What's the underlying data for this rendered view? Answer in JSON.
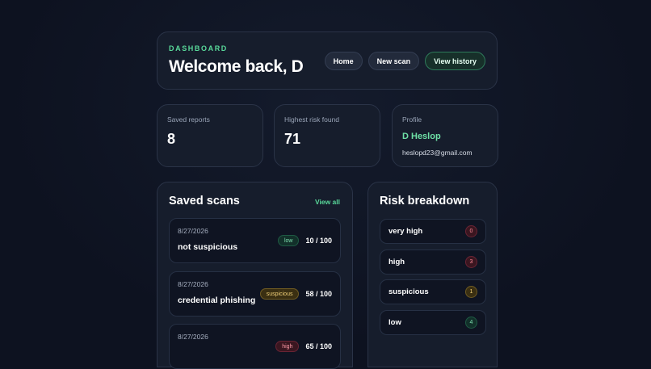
{
  "header": {
    "eyebrow": "DASHBOARD",
    "title": "Welcome back, D",
    "nav": [
      "Home",
      "New scan",
      "View history"
    ]
  },
  "stats": {
    "saved_reports": {
      "label": "Saved reports",
      "value": "8"
    },
    "highest_risk": {
      "label": "Highest risk found",
      "value": "71"
    },
    "profile": {
      "label": "Profile",
      "name": "D Heslop",
      "email": "heslopd23@gmail.com"
    }
  },
  "saved_scans": {
    "title": "Saved scans",
    "view_all": "View all",
    "items": [
      {
        "date": "8/27/2026",
        "name": "not suspicious",
        "badge": "low",
        "score": "10 / 100"
      },
      {
        "date": "8/27/2026",
        "name": "credential phishing",
        "badge": "suspicious",
        "score": "58 / 100"
      },
      {
        "date": "8/27/2026",
        "name": "",
        "badge": "high",
        "score": "65 / 100"
      }
    ]
  },
  "risk_breakdown": {
    "title": "Risk breakdown",
    "items": [
      {
        "label": "very high",
        "count": "0"
      },
      {
        "label": "high",
        "count": "3"
      },
      {
        "label": "suspicious",
        "count": "1"
      },
      {
        "label": "low",
        "count": "4"
      }
    ]
  },
  "colors": {
    "accent": "#59d99a",
    "background": "#0d1220",
    "card": "#161d2c"
  }
}
